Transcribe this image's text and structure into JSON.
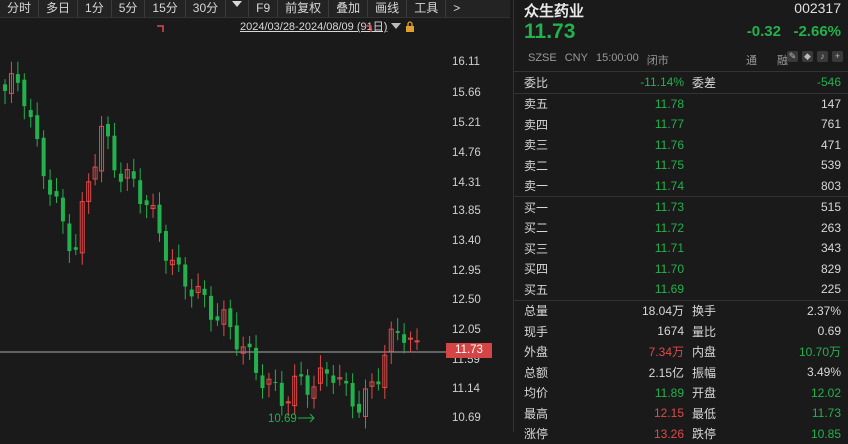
{
  "toolbar": {
    "items": [
      "分时",
      "多日",
      "1分",
      "5分",
      "15分",
      "30分",
      "F9",
      "前复权",
      "叠加",
      "画线",
      "工具",
      ">"
    ]
  },
  "range": {
    "label": "2024/03/28-2024/08/09 (91日)"
  },
  "axis": {
    "labels": [
      "16.11",
      "15.66",
      "15.21",
      "14.76",
      "14.31",
      "13.85",
      "13.40",
      "12.95",
      "12.50",
      "12.05",
      "11.59",
      "11.14",
      "10.69"
    ]
  },
  "current_price_tag": "11.73",
  "low_marker": "10.69",
  "colors": {
    "up": "#e04a4a",
    "down": "#22b14c",
    "price_tag": "#d64545",
    "bg": "#1a1a1a"
  },
  "stock": {
    "name": "众生药业",
    "code": "002317",
    "price": "11.73",
    "change": "-0.32",
    "change_pct": "-2.66%",
    "market": "SZSE",
    "currency": "CNY",
    "time": "15:00:00",
    "status": "闭市",
    "link1": "通",
    "link2": "融"
  },
  "ratio": {
    "label": "委比",
    "value": "-11.14%",
    "label2": "委差",
    "value2": "-546"
  },
  "sells": [
    {
      "label": "卖五",
      "price": "11.78",
      "vol": "147"
    },
    {
      "label": "卖四",
      "price": "11.77",
      "vol": "761"
    },
    {
      "label": "卖三",
      "price": "11.76",
      "vol": "471"
    },
    {
      "label": "卖二",
      "price": "11.75",
      "vol": "539"
    },
    {
      "label": "卖一",
      "price": "11.74",
      "vol": "803"
    }
  ],
  "buys": [
    {
      "label": "买一",
      "price": "11.73",
      "vol": "515"
    },
    {
      "label": "买二",
      "price": "11.72",
      "vol": "263"
    },
    {
      "label": "买三",
      "price": "11.71",
      "vol": "343"
    },
    {
      "label": "买四",
      "price": "11.70",
      "vol": "829"
    },
    {
      "label": "买五",
      "price": "11.69",
      "vol": "225"
    }
  ],
  "stats": [
    {
      "l1": "总量",
      "v1": "18.04万",
      "c1": "white",
      "l2": "换手",
      "v2": "2.37%",
      "c2": "white"
    },
    {
      "l1": "现手",
      "v1": "1674",
      "c1": "white",
      "l2": "量比",
      "v2": "0.69",
      "c2": "white"
    },
    {
      "l1": "外盘",
      "v1": "7.34万",
      "c1": "red",
      "l2": "内盘",
      "v2": "10.70万",
      "c2": "green"
    },
    {
      "l1": "总额",
      "v1": "2.15亿",
      "c1": "white",
      "l2": "振幅",
      "v2": "3.49%",
      "c2": "white"
    },
    {
      "l1": "均价",
      "v1": "11.89",
      "c1": "green",
      "l2": "开盘",
      "v2": "12.02",
      "c2": "green"
    },
    {
      "l1": "最高",
      "v1": "12.15",
      "c1": "red",
      "l2": "最低",
      "v2": "11.73",
      "c2": "green"
    },
    {
      "l1": "涨停",
      "v1": "13.26",
      "c1": "red",
      "l2": "跌停",
      "v2": "10.85",
      "c2": "green"
    }
  ]
}
